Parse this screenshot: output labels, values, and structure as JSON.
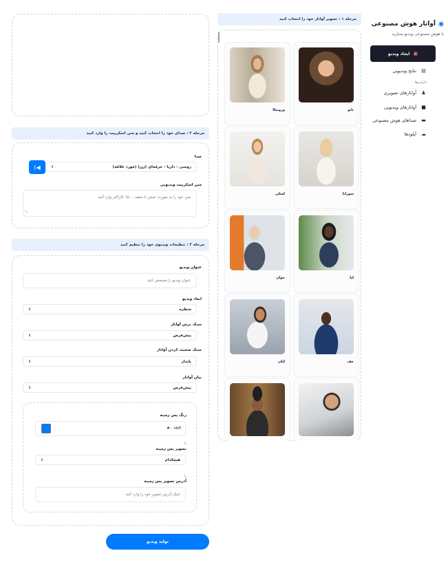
{
  "sidebar": {
    "title": "آواتار هوش مصنوعی",
    "subtitle": "با هوش مصنوعی ویدیو بسازید",
    "create_button": "ایجاد ویدیو",
    "items": [
      {
        "label": "نتایج ویدیویی",
        "icon": "video-library-icon"
      }
    ],
    "section_label": "دارایی‌ها",
    "assets": [
      {
        "label": "آواتارهای تصویری",
        "icon": "person-icon"
      },
      {
        "label": "آواتارهای ویدیویی",
        "icon": "video-camera-icon"
      },
      {
        "label": "صداهای هوش مصنوعی",
        "icon": "chat-icon"
      },
      {
        "label": "آپلودها",
        "icon": "cloud-upload-icon"
      }
    ]
  },
  "step1": {
    "header": "مرحله ۱ : تصویر آواتار خود را انتخاب کنید",
    "avatars": [
      {
        "name": "بانو"
      },
      {
        "name": "ورونیکا"
      },
      {
        "name": "سوزانا"
      },
      {
        "name": "لسلی"
      },
      {
        "name": "لیا"
      },
      {
        "name": "جوان"
      },
      {
        "name": "جف"
      },
      {
        "name": "لئان"
      },
      {
        "name": ""
      },
      {
        "name": ""
      }
    ]
  },
  "step2": {
    "header": "مرحله ۲ : صدای خود را انتخاب کنید و متن اسکریپت را وارد کنید",
    "voice_label": "صدا",
    "voice_value": "روسی - داریا - حرفه‌ای (زن) (مورد علاقه)",
    "script_label": "متن اسکریپت ویدیویی",
    "script_placeholder": "متن خود را به صورت عیش تا سقف ۱۵۰۰ کاراکتر وارد کنید"
  },
  "step3": {
    "header": "مرحله ۳ : تنظیمات ویدیوی خود را تنظیم کنید",
    "title_label": "عنوان ویدیو",
    "title_placeholder": "عنوان ویدیو را مشخص کنید",
    "dimension_label": "ابعاد ویدیو",
    "dimension_value": "منظره",
    "crop_label": "سبک برش آواتار",
    "crop_value": "پیش‌فرض",
    "speak_label": "سبک صحبت کردن آواتار",
    "speak_value": "پایدار",
    "expression_label": "بیان آواتار",
    "expression_value": "پیش‌فرض",
    "bg_color_label": "رنگ پس زمینه",
    "bg_color_value": "#۰۰۷bff",
    "bg_color": "#007bff",
    "or1": "یا",
    "bg_image_label": "تصویر پس زمینه",
    "bg_image_value": "هیچکدام",
    "or2": "یا",
    "bg_url_label": "آدرس تصویر پس زمینه",
    "bg_url_placeholder": "لینک آدرس تصویر خود را وارد کنید"
  },
  "generate_button": "تولید ویدیو",
  "colors": {
    "accent": "#007bff",
    "dark_button": "#1a1d29"
  }
}
